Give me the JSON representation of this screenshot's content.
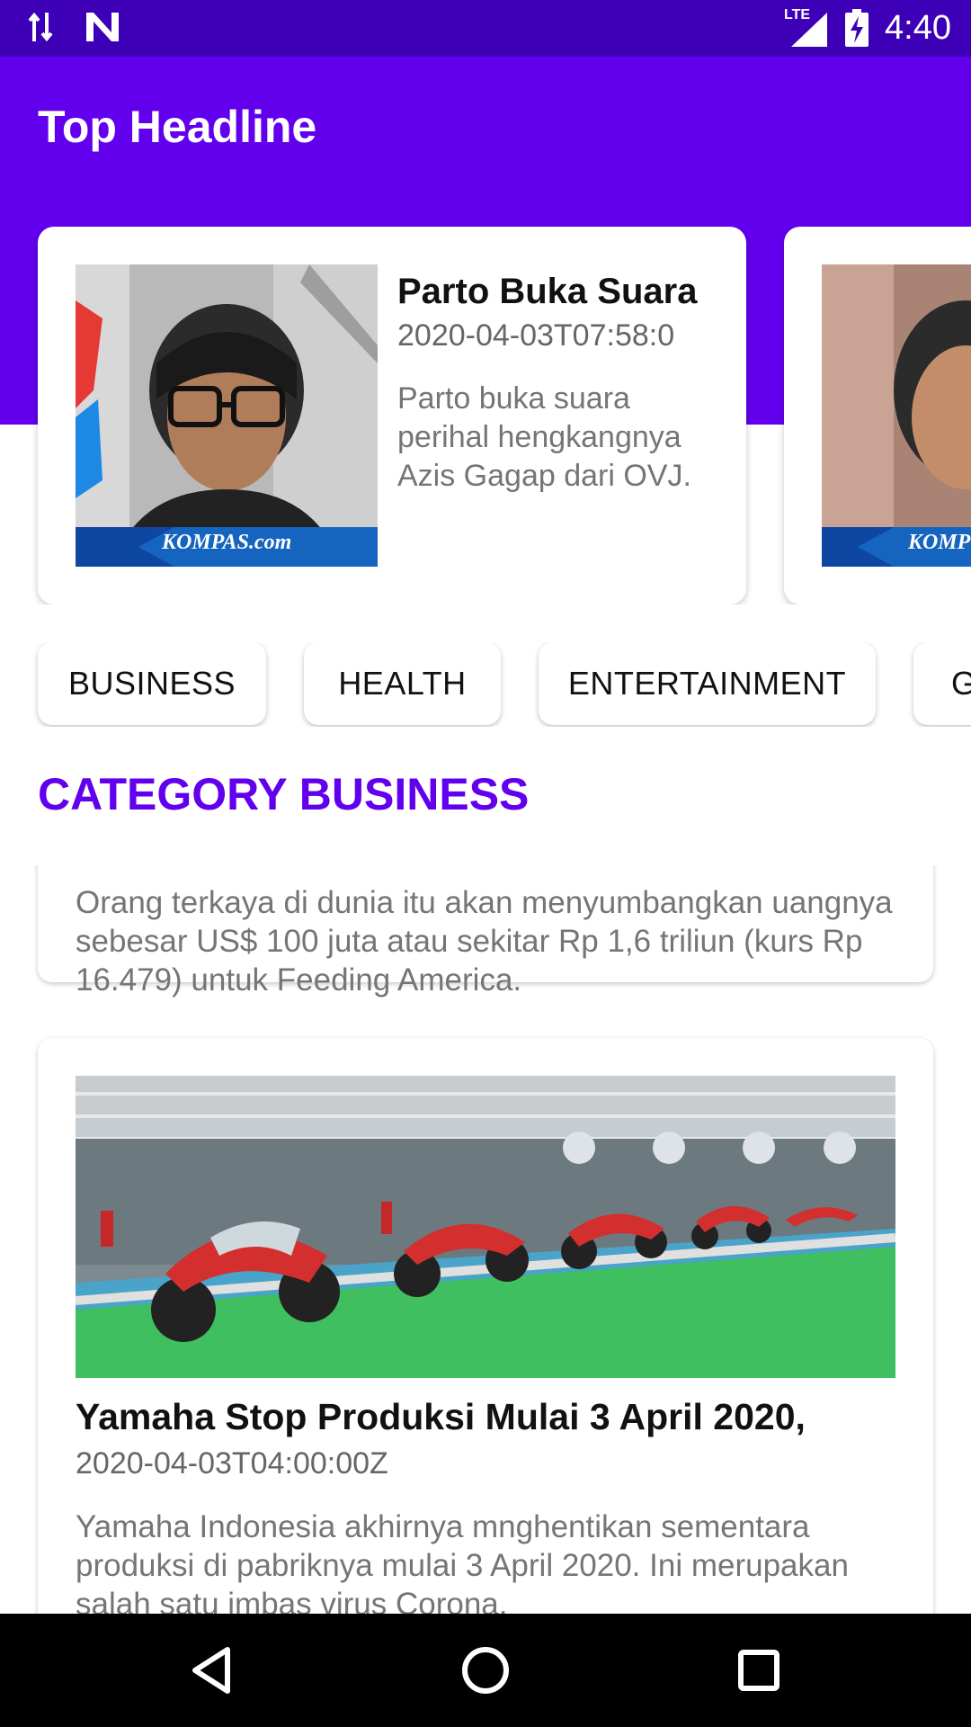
{
  "status_bar": {
    "time": "4:40",
    "network": "LTE",
    "icons": [
      "data-transfer-icon",
      "notification-n-icon",
      "lte-signal-icon",
      "battery-charging-icon"
    ]
  },
  "app": {
    "title": "Top Headline"
  },
  "headlines": [
    {
      "title": "Parto Buka Suara",
      "date": "2020-04-03T07:58:0",
      "description": "Parto buka suara perihal hengkangnya Azis Gagap dari OVJ.",
      "image_caption": "KOMPAS.com"
    },
    {
      "image_caption": "KOMP"
    }
  ],
  "categories": [
    "BUSINESS",
    "HEALTH",
    "ENTERTAINMENT",
    "G"
  ],
  "section": {
    "title": "CATEGORY BUSINESS"
  },
  "news": [
    {
      "description": "Orang terkaya di dunia itu akan menyumbangkan uangnya sebesar US$ 100 juta atau sekitar Rp 1,6 triliun (kurs Rp 16.479) untuk Feeding America."
    },
    {
      "title": "Yamaha Stop Produksi Mulai 3 April 2020,",
      "date": "2020-04-03T04:00:00Z",
      "description": "Yamaha Indonesia akhirnya mnghentikan sementara produksi di pabriknya mulai 3 April 2020. Ini merupakan salah satu imbas virus Corona."
    }
  ],
  "colors": {
    "status_bar": "#3d00b6",
    "primary": "#6200ee",
    "nav_bar": "#000000"
  },
  "navigation": {
    "icons": [
      "back-icon",
      "home-icon",
      "recents-icon"
    ]
  }
}
